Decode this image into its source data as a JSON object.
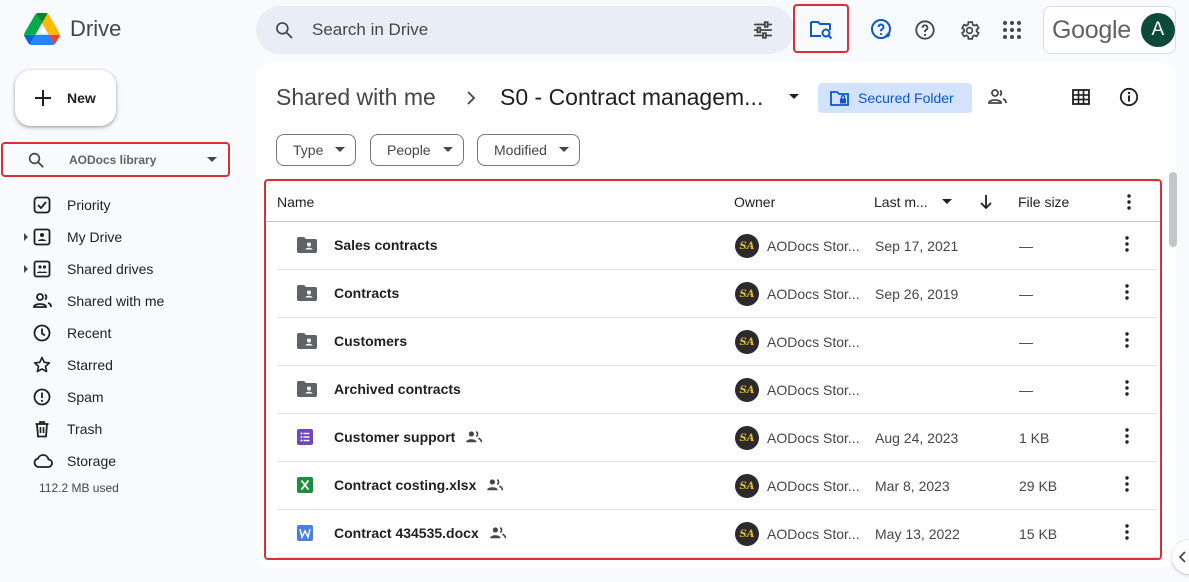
{
  "app": {
    "name": "Drive"
  },
  "search": {
    "placeholder": "Search in Drive"
  },
  "account": {
    "brand": "Google",
    "avatar_letter": "A"
  },
  "sidebar": {
    "new_label": "New",
    "library_label": "AODocs library",
    "items": [
      {
        "label": "Priority",
        "icon": "checkbox-icon"
      },
      {
        "label": "My Drive",
        "icon": "my-drive-icon"
      },
      {
        "label": "Shared drives",
        "icon": "shared-drives-icon"
      },
      {
        "label": "Shared with me",
        "icon": "people-icon"
      },
      {
        "label": "Recent",
        "icon": "clock-icon"
      },
      {
        "label": "Starred",
        "icon": "star-icon"
      },
      {
        "label": "Spam",
        "icon": "spam-icon"
      },
      {
        "label": "Trash",
        "icon": "trash-icon"
      },
      {
        "label": "Storage",
        "icon": "cloud-icon"
      }
    ],
    "storage_used": "112.2 MB used"
  },
  "breadcrumb": {
    "parent": "Shared with me",
    "current": "S0 - Contract managem..."
  },
  "secured_label": "Secured Folder",
  "filters": [
    "Type",
    "People",
    "Modified"
  ],
  "table": {
    "headers": {
      "name": "Name",
      "owner": "Owner",
      "modified": "Last m...",
      "size": "File size"
    },
    "rows": [
      {
        "name": "Sales contracts",
        "type": "shared-folder",
        "owner": "AODocs Stor...",
        "modified": "Sep 17, 2021",
        "size": "—",
        "shared": false
      },
      {
        "name": "Contracts",
        "type": "shared-folder",
        "owner": "AODocs Stor...",
        "modified": "Sep 26, 2019",
        "size": "—",
        "shared": false
      },
      {
        "name": "Customers",
        "type": "shared-folder",
        "owner": "AODocs Stor...",
        "modified": "",
        "size": "—",
        "shared": false
      },
      {
        "name": "Archived contracts",
        "type": "shared-folder",
        "owner": "AODocs Stor...",
        "modified": "",
        "size": "—",
        "shared": false
      },
      {
        "name": "Customer support",
        "type": "form",
        "owner": "AODocs Stor...",
        "modified": "Aug 24, 2023",
        "size": "1 KB",
        "shared": true
      },
      {
        "name": "Contract costing.xlsx",
        "type": "excel",
        "owner": "AODocs Stor...",
        "modified": "Mar 8, 2023",
        "size": "29 KB",
        "shared": true
      },
      {
        "name": "Contract 434535.docx",
        "type": "word",
        "owner": "AODocs Stor...",
        "modified": "May 13, 2022",
        "size": "15 KB",
        "shared": true
      }
    ],
    "owner_avatar_text": "SA"
  },
  "colors": {
    "accent": "#0b57d0",
    "highlight": "#d93036",
    "background": "#f8fafd"
  }
}
